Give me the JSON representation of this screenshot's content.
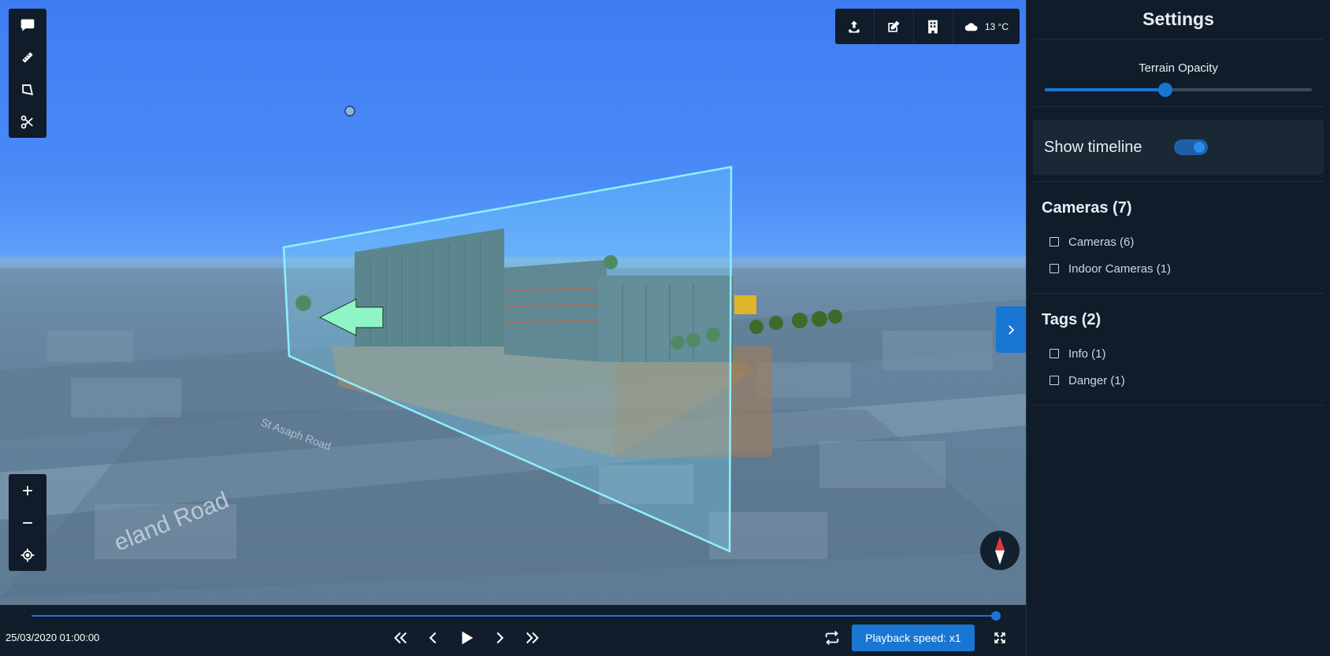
{
  "settings": {
    "title": "Settings",
    "terrain_opacity_label": "Terrain Opacity",
    "terrain_opacity_value": 0.45,
    "show_timeline_label": "Show timeline",
    "show_timeline_on": true,
    "groups": [
      {
        "title": "Cameras (7)",
        "items": [
          "Cameras (6)",
          "Indoor Cameras (1)"
        ]
      },
      {
        "title": "Tags (2)",
        "items": [
          "Info (1)",
          "Danger (1)"
        ]
      }
    ]
  },
  "toolbar": {
    "weather_temp": "13 °C",
    "icons": [
      "upload-icon",
      "edit-icon",
      "building-icon",
      "cloud-icon"
    ]
  },
  "left_tools": [
    "comment-icon",
    "ruler-icon",
    "polygon-icon",
    "scissors-icon"
  ],
  "zoom_tools": [
    "zoom-in-icon",
    "zoom-out-icon",
    "locate-icon"
  ],
  "map_labels": {
    "road_1": "eland Road",
    "road_2": "St Asaph Road"
  },
  "timeline": {
    "date": "25/03/2020 01:00:00",
    "progress": 1.0,
    "speed_label": "Playback speed: x1"
  },
  "colors": {
    "accent": "#1976d2",
    "panel": "#111c2a",
    "clip_plane": "#7fe0ff"
  }
}
